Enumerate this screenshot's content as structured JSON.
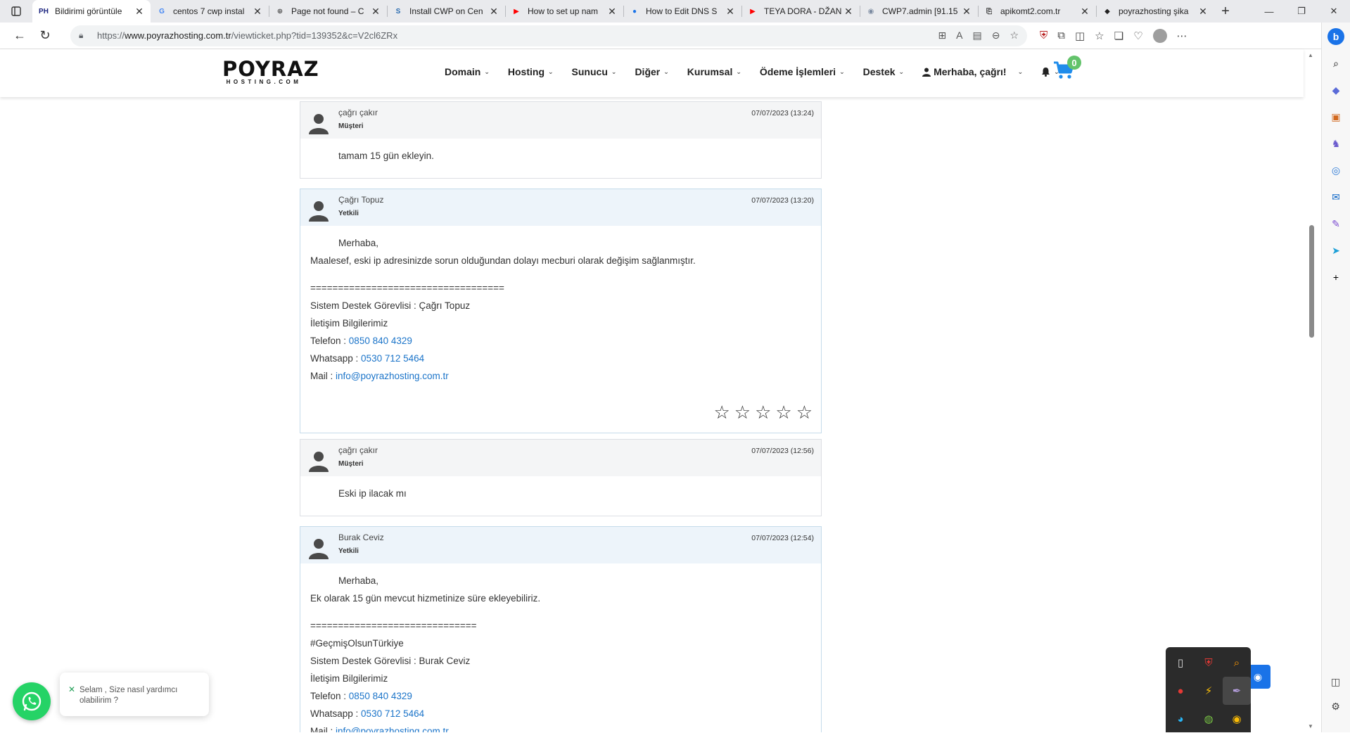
{
  "browser": {
    "tabs": [
      {
        "label": "Bildirimi görüntüle",
        "favicon": "PH",
        "favicon_color": "#1a237e",
        "active": true
      },
      {
        "label": "centos 7 cwp instal",
        "favicon": "G",
        "favicon_color": "#4285f4"
      },
      {
        "label": "Page not found – C",
        "favicon": "⊕",
        "favicon_color": "#555555"
      },
      {
        "label": "Install CWP on Cen",
        "favicon": "S",
        "favicon_color": "#2b6cb0"
      },
      {
        "label": "How to set up nam",
        "favicon": "▶",
        "favicon_color": "#ff0000"
      },
      {
        "label": "How to Edit DNS S",
        "favicon": "●",
        "favicon_color": "#1a73e8"
      },
      {
        "label": "TEYA DORA - DŽAN",
        "favicon": "▶",
        "favicon_color": "#ff0000"
      },
      {
        "label": "CWP7.admin [91.15",
        "favicon": "◉",
        "favicon_color": "#7a8aa0"
      },
      {
        "label": "apikomt2.com.tr",
        "favicon": "⎘",
        "favicon_color": "#333333"
      },
      {
        "label": "poyrazhosting şika",
        "favicon": "◆",
        "favicon_color": "#222222"
      }
    ],
    "url": {
      "scheme": "https://",
      "host": "www.poyrazhosting.com.tr",
      "path": "/viewticket.php?tid=139352&c=V2cl6ZRx"
    }
  },
  "site": {
    "logo_main": "POYRAZ",
    "logo_sub": "HOSTING.COM",
    "nav": [
      "Domain",
      "Hosting",
      "Sunucu",
      "Diğer",
      "Kurumsal",
      "Ödeme İşlemleri",
      "Destek"
    ],
    "user_greeting": "Merhaba, çağrı!",
    "cart_count": "0"
  },
  "replies": [
    {
      "name": "çağrı çakır",
      "role": "Müşteri",
      "date": "07/07/2023 (13:24)",
      "staff": false,
      "body": {
        "line1": "tamam 15 gün ekleyin."
      }
    },
    {
      "name": "Çağrı Topuz",
      "role": "Yetkili",
      "date": "07/07/2023 (13:20)",
      "staff": true,
      "body": {
        "greeting": "Merhaba,",
        "message": "Maalesef, eski ip adresinizde sorun olduğundan dolayı mecburi olarak değişim sağlanmıştır.",
        "separator": "===================================",
        "agent": "Sistem Destek Görevlisi : Çağrı Topuz",
        "contact_title": "İletişim Bilgilerimiz",
        "phone_label": "Telefon : ",
        "phone": "0850 840 4329",
        "whatsapp_label": "Whatsapp : ",
        "whatsapp": "0530 712 5464",
        "mail_label": "Mail : ",
        "mail": "info@poyrazhosting.com.tr"
      },
      "rating": 0,
      "rating_max": 5
    },
    {
      "name": "çağrı çakır",
      "role": "Müşteri",
      "date": "07/07/2023 (12:56)",
      "staff": false,
      "body": {
        "line1": "Eski ip ilacak mı"
      }
    },
    {
      "name": "Burak Ceviz",
      "role": "Yetkili",
      "date": "07/07/2023 (12:54)",
      "staff": true,
      "body": {
        "greeting": "Merhaba,",
        "message": "Ek olarak 15 gün mevcut hizmetinize süre ekleyebiliriz.",
        "separator": "==============================",
        "hashtag": "#GeçmişOlsunTürkiye",
        "agent": "Sistem Destek Görevlisi : Burak Ceviz",
        "contact_title": "İletişim Bilgilerimiz",
        "phone_label": "Telefon : ",
        "phone": "0850 840 4329",
        "whatsapp_label": "Whatsapp : ",
        "whatsapp": "0530 712 5464",
        "mail_label": "Mail : ",
        "mail": "info@poyrazhosting.com.tr"
      }
    }
  ],
  "whatsapp_widget": {
    "message": "Selam , Size nasıl yardımcı olabilirim ?"
  },
  "colors": {
    "link": "#1b74c9",
    "cart": "#1f8ceb",
    "cart_badge": "#63c36b",
    "whatsapp": "#25d366"
  }
}
